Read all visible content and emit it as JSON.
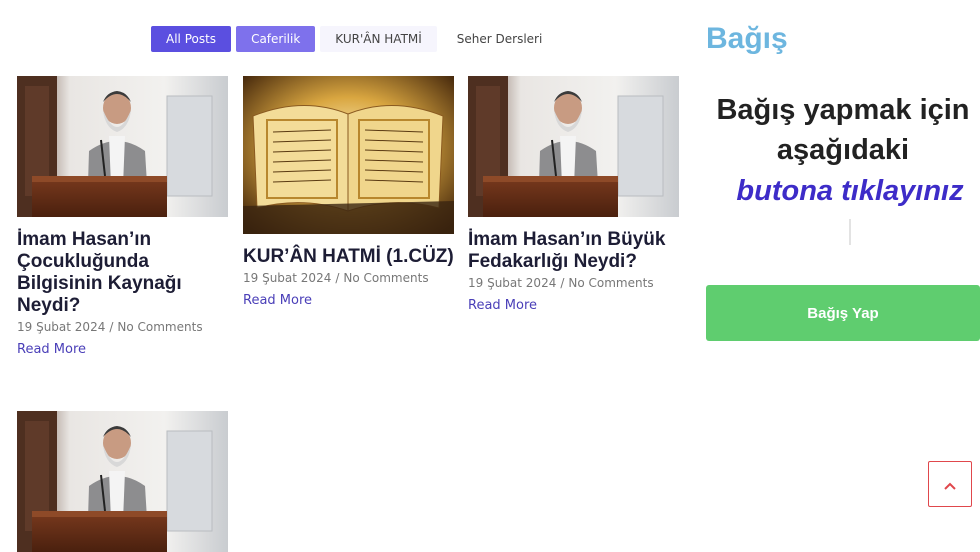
{
  "filters": [
    "All Posts",
    "Caferilik",
    "KUR'ÂN HATMİ",
    "Seher Dersleri"
  ],
  "posts": [
    {
      "title": "İmam Hasan’ın Çocukluğunda Bilgisinin Kaynağı Neydi?",
      "date": "19 Şubat 2024",
      "comments": "No Comments",
      "read_more": "Read More",
      "image": "speaker-photo"
    },
    {
      "title": "KUR’ÂN HATMİ (1.CÜZ)",
      "date": "19 Şubat 2024",
      "comments": "No Comments",
      "read_more": "Read More",
      "image": "quran-photo"
    },
    {
      "title": "İmam Hasan’ın Büyük Fedakarlığı Neydi?",
      "date": "19 Şubat 2024",
      "comments": "No Comments",
      "read_more": "Read More",
      "image": "speaker-photo"
    },
    {
      "image": "speaker-photo"
    }
  ],
  "sidebar": {
    "title": "Bağış",
    "text": "Bağış yapmak için aşağıdaki",
    "emphasis": "butona tıklayınız",
    "button": "Bağış Yap"
  },
  "colors": {
    "accent": "#5b4fe0",
    "donate": "#5fcd6f",
    "sidebar_title": "#6db6df",
    "emphasis": "#3d2cc8"
  },
  "icons": {
    "scroll_top": "chevron-up-icon"
  }
}
